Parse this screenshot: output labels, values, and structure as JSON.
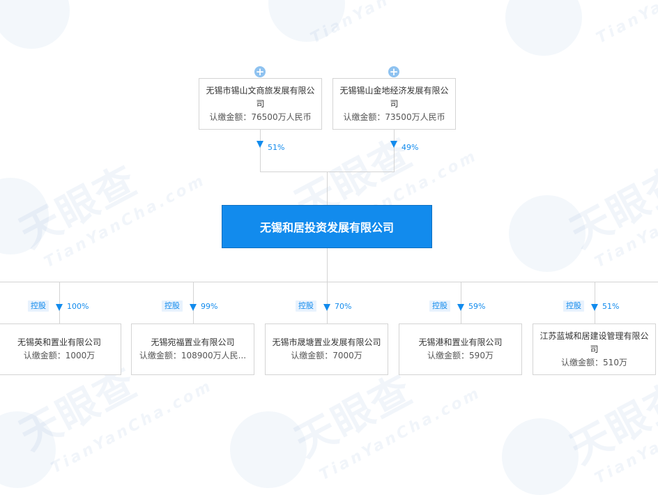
{
  "watermark": {
    "main": "天眼查",
    "sub": "TianYanCha.com",
    "sub_short": "TianYan"
  },
  "colors": {
    "accent": "#128bed",
    "line": "#d4d4d4",
    "plus": "#8ec2f0",
    "tag_bg": "#e8f2fd"
  },
  "shareholders": [
    {
      "name": "无锡市锡山文商旅发展有限公司",
      "amount": "认缴金额：76500万人民币",
      "percent": "51%",
      "icon": "plus-circle-icon"
    },
    {
      "name": "无锡锡山金地经济发展有限公司",
      "amount": "认缴金额：73500万人民币",
      "percent": "49%",
      "icon": "plus-circle-icon"
    }
  ],
  "company": {
    "name": "无锡和居投资发展有限公司"
  },
  "subsidiaries": [
    {
      "tag": "控股",
      "percent": "100%",
      "name": "无锡英和置业有限公司",
      "amount": "认缴金额：1000万"
    },
    {
      "tag": "控股",
      "percent": "99%",
      "name": "无锡宛福置业有限公司",
      "amount": "认缴金额：108900万人民..."
    },
    {
      "tag": "控股",
      "percent": "70%",
      "name": "无锡市晟塘置业发展有限公司",
      "amount": "认缴金额：7000万"
    },
    {
      "tag": "控股",
      "percent": "59%",
      "name": "无锡港和置业有限公司",
      "amount": "认缴金额：590万"
    },
    {
      "tag": "控股",
      "percent": "51%",
      "name": "江苏蓝城和居建设管理有限公司",
      "amount": "认缴金额：510万"
    }
  ]
}
